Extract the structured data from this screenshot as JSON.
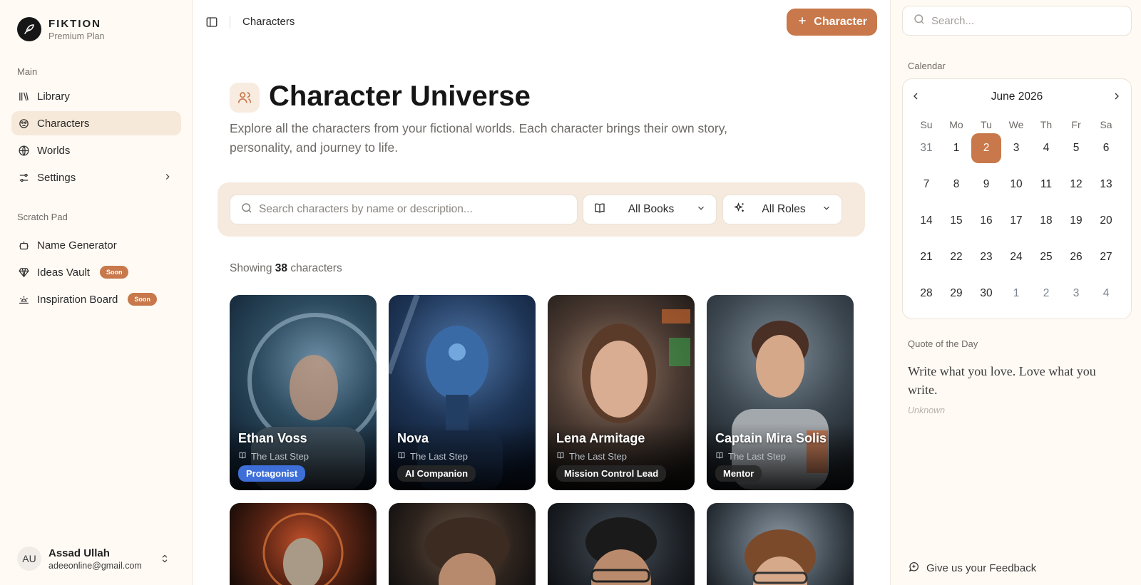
{
  "brand": {
    "name": "FIKTION",
    "plan": "Premium Plan"
  },
  "sidebar": {
    "main_label": "Main",
    "items": [
      {
        "label": "Library",
        "icon": "library-icon"
      },
      {
        "label": "Characters",
        "icon": "characters-icon",
        "active": true
      },
      {
        "label": "Worlds",
        "icon": "globe-icon"
      },
      {
        "label": "Settings",
        "icon": "settings-icon"
      }
    ],
    "scratch_label": "Scratch Pad",
    "scratch_items": [
      {
        "label": "Name Generator",
        "icon": "robot-icon"
      },
      {
        "label": "Ideas Vault",
        "icon": "gem-icon",
        "badge": "Soon"
      },
      {
        "label": "Inspiration Board",
        "icon": "sunrise-icon",
        "badge": "Soon"
      }
    ]
  },
  "user": {
    "initials": "AU",
    "name": "Assad Ullah",
    "email": "adeeonline@gmail.com"
  },
  "topbar": {
    "breadcrumb": "Characters",
    "add_label": "Character"
  },
  "page": {
    "title": "Character Universe",
    "description": "Explore all the characters from your fictional worlds. Each character brings their own story, personality, and journey to life."
  },
  "filters": {
    "search_placeholder": "Search characters by name or description...",
    "books_value": "All Books",
    "roles_value": "All Roles"
  },
  "results": {
    "prefix": "Showing",
    "count": "38",
    "suffix": "characters"
  },
  "characters": [
    {
      "name": "Ethan Voss",
      "book": "The Last Step",
      "role": "Protagonist"
    },
    {
      "name": "Nova",
      "book": "The Last Step",
      "role": "AI Companion"
    },
    {
      "name": "Lena Armitage",
      "book": "The Last Step",
      "role": "Mission Control Lead"
    },
    {
      "name": "Captain Mira Solis",
      "book": "The Last Step",
      "role": "Mentor"
    }
  ],
  "right": {
    "search_placeholder": "Search...",
    "calendar_label": "Calendar",
    "month": "June 2026",
    "weekdays": [
      "Su",
      "Mo",
      "Tu",
      "We",
      "Th",
      "Fr",
      "Sa"
    ],
    "days": [
      "31",
      "1",
      "2",
      "3",
      "4",
      "5",
      "6",
      "7",
      "8",
      "9",
      "10",
      "11",
      "12",
      "13",
      "14",
      "15",
      "16",
      "17",
      "18",
      "19",
      "20",
      "21",
      "22",
      "23",
      "24",
      "25",
      "26",
      "27",
      "28",
      "29",
      "30",
      "1",
      "2",
      "3",
      "4"
    ],
    "quote_label": "Quote of the Day",
    "quote": "Write what you love. Love what you write.",
    "quote_author": "Unknown",
    "feedback": "Give us your Feedback"
  },
  "colors": {
    "accent": "#c8784a",
    "role_blue": "#3e6fd8"
  }
}
